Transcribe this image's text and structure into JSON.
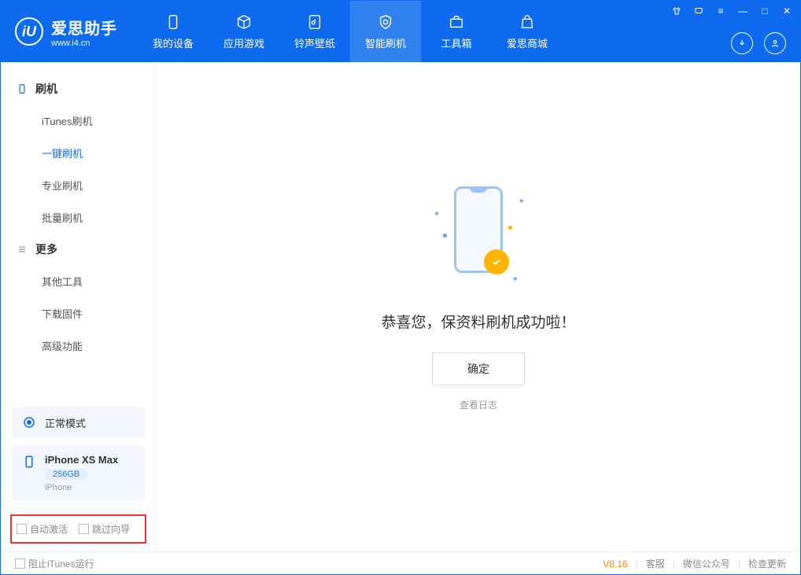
{
  "app": {
    "name": "爱思助手",
    "url": "www.i4.cn"
  },
  "nav": {
    "items": [
      {
        "label": "我的设备"
      },
      {
        "label": "应用游戏"
      },
      {
        "label": "铃声壁纸"
      },
      {
        "label": "智能刷机"
      },
      {
        "label": "工具箱"
      },
      {
        "label": "爱思商城"
      }
    ]
  },
  "sidebar": {
    "section1": {
      "title": "刷机",
      "items": [
        "iTunes刷机",
        "一键刷机",
        "专业刷机",
        "批量刷机"
      ]
    },
    "section2": {
      "title": "更多",
      "items": [
        "其他工具",
        "下载固件",
        "高级功能"
      ]
    },
    "mode": "正常模式",
    "device": {
      "name": "iPhone XS Max",
      "storage": "256GB",
      "type": "iPhone"
    },
    "options": {
      "auto_activate": "自动激活",
      "skip_guide": "跳过向导"
    }
  },
  "main": {
    "success_message": "恭喜您，保资料刷机成功啦！",
    "confirm": "确定",
    "view_log": "查看日志"
  },
  "footer": {
    "block_itunes": "阻止iTunes运行",
    "version": "V8.16",
    "links": [
      "客服",
      "微信公众号",
      "检查更新"
    ]
  }
}
